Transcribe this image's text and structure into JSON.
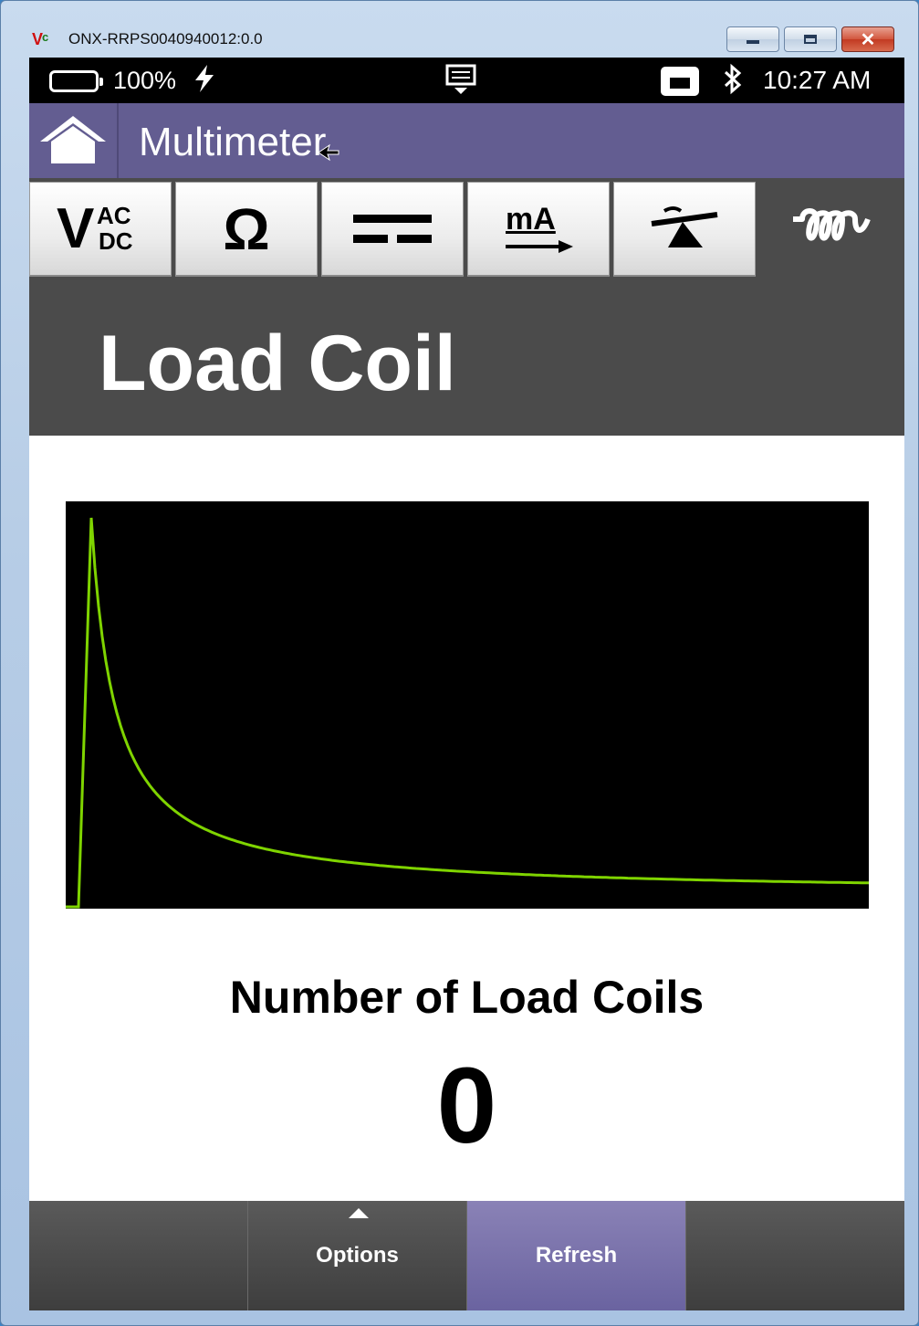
{
  "window": {
    "title": "ONX-RRPS0040940012:0.0",
    "icon_text_v": "V",
    "icon_text_c": "c"
  },
  "status_bar": {
    "battery_percent": "100%",
    "time": "10:27 AM",
    "icons": [
      "battery-icon",
      "charging-bolt-icon",
      "notification-tray-icon",
      "ethernet-icon",
      "bluetooth-icon"
    ]
  },
  "app_bar": {
    "title": "Multimeter"
  },
  "tabs": [
    {
      "name": "vac-vdc",
      "icon": "vac-vdc-icon",
      "label_main": "V",
      "label_top": "AC",
      "label_bottom": "DC"
    },
    {
      "name": "ohms",
      "icon": "ohm-icon",
      "label_main": "Ω"
    },
    {
      "name": "capacitance",
      "icon": "capacitance-icon"
    },
    {
      "name": "milliamps",
      "icon": "milliamp-icon",
      "label_main": "mA"
    },
    {
      "name": "balance",
      "icon": "balance-icon"
    },
    {
      "name": "load-coil",
      "icon": "coil-icon",
      "active": true
    }
  ],
  "mode": {
    "title": "Load Coil"
  },
  "graph": {
    "trace_color": "#7fd400",
    "background": "#000000"
  },
  "result": {
    "label": "Number of Load Coils",
    "value": "0"
  },
  "bottom_bar": {
    "options_label": "Options",
    "refresh_label": "Refresh"
  }
}
